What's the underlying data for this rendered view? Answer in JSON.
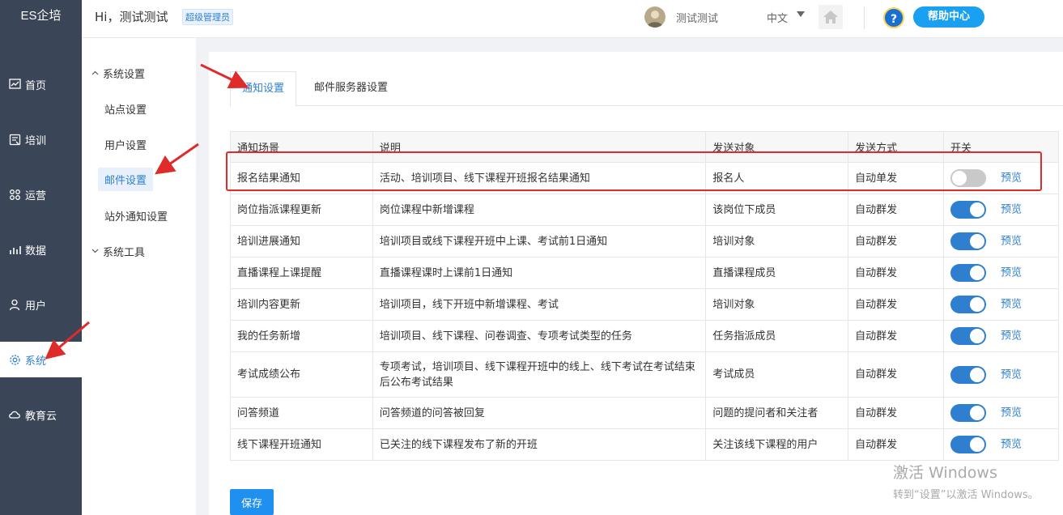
{
  "app": {
    "logo": "ES企培",
    "greeting": "Hi，测试测试",
    "role_badge": "超级管理员",
    "user_name": "测试测试",
    "language": "中文",
    "help_label": "帮助中心",
    "help_icon": "?"
  },
  "left_nav": [
    {
      "label": "首页",
      "icon": "dashboard-icon",
      "active": false
    },
    {
      "label": "培训",
      "icon": "training-icon",
      "active": false
    },
    {
      "label": "运营",
      "icon": "operation-icon",
      "active": false
    },
    {
      "label": "数据",
      "icon": "chart-icon",
      "active": false
    },
    {
      "label": "用户",
      "icon": "user-icon",
      "active": false
    },
    {
      "label": "系统",
      "icon": "gear-icon",
      "active": true
    },
    {
      "label": "教育云",
      "icon": "cloud-icon",
      "active": false
    }
  ],
  "submenu": {
    "group1": "系统设置",
    "items": [
      "站点设置",
      "用户设置",
      "邮件设置",
      "站外通知设置"
    ],
    "active_item": "邮件设置",
    "group2": "系统工具"
  },
  "tabs": [
    {
      "label": "通知设置",
      "active": true
    },
    {
      "label": "邮件服务器设置",
      "active": false
    }
  ],
  "table": {
    "headers": [
      "通知场景",
      "说明",
      "发送对象",
      "发送方式",
      "开关"
    ],
    "preview_label": "预览",
    "rows": [
      {
        "scene": "报名结果通知",
        "desc": "活动、培训项目、线下课程开班报名结果通知",
        "target": "报名人",
        "method": "自动单发",
        "enabled": false
      },
      {
        "scene": "岗位指派课程更新",
        "desc": "岗位课程中新增课程",
        "target": "该岗位下成员",
        "method": "自动群发",
        "enabled": true
      },
      {
        "scene": "培训进展通知",
        "desc": "培训项目或线下课程开班中上课、考试前1日通知",
        "target": "培训对象",
        "method": "自动群发",
        "enabled": true
      },
      {
        "scene": "直播课程上课提醒",
        "desc": "直播课程课时上课前1日通知",
        "target": "直播课程成员",
        "method": "自动群发",
        "enabled": true
      },
      {
        "scene": "培训内容更新",
        "desc": "培训项目，线下开班中新增课程、考试",
        "target": "培训对象",
        "method": "自动群发",
        "enabled": true
      },
      {
        "scene": "我的任务新增",
        "desc": "培训项目、线下课程、问卷调查、专项考试类型的任务",
        "target": "任务指派成员",
        "method": "自动群发",
        "enabled": true
      },
      {
        "scene": "考试成绩公布",
        "desc": "专项考试，培训项目、线下课程开班中的线上、线下考试在考试结束后公布考试结果",
        "target": "考试成员",
        "method": "自动群发",
        "enabled": true
      },
      {
        "scene": "问答频道",
        "desc": "问答频道的问答被回复",
        "target": "问题的提问者和关注者",
        "method": "自动群发",
        "enabled": true
      },
      {
        "scene": "线下课程开班通知",
        "desc": "已关注的线下课程发布了新的开班",
        "target": "关注该线下课程的用户",
        "method": "自动群发",
        "enabled": true
      }
    ]
  },
  "save_label": "保存",
  "windows_watermark": {
    "line1": "激活 Windows",
    "line2": "转到“设置”以激活 Windows。"
  },
  "colors": {
    "sidebar": "#3b4558",
    "accent": "#2f7fd1",
    "annotation_red": "#e02b2b"
  }
}
